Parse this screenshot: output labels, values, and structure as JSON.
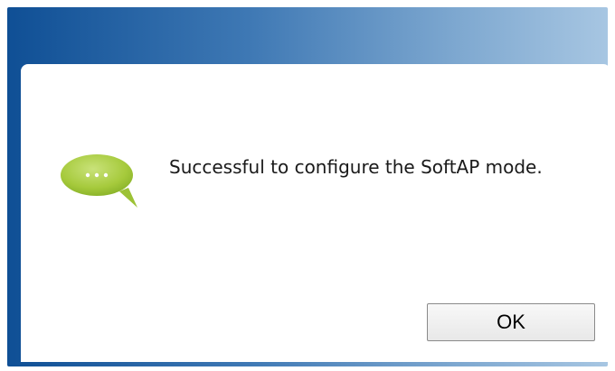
{
  "dialog": {
    "message": "Successful to configure the SoftAP mode.",
    "ok_label": "OK",
    "icon": "speech-bubble-icon",
    "colors": {
      "title_bar_left": "#0f4f95",
      "title_bar_right": "#a7c6e2",
      "icon_green": "#a8cc3d",
      "background": "#ffffff"
    }
  }
}
